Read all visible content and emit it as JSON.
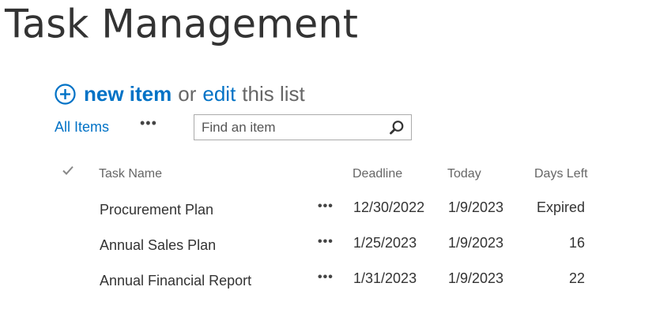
{
  "page": {
    "title": "Task Management"
  },
  "actions": {
    "new_item": "new item",
    "or": "or",
    "edit": "edit",
    "this_list": "this list"
  },
  "views": {
    "all_items": "All Items",
    "more": "•••"
  },
  "search": {
    "placeholder": "Find an item",
    "value": ""
  },
  "table": {
    "headers": {
      "task_name": "Task Name",
      "deadline": "Deadline",
      "today": "Today",
      "days_left": "Days Left"
    },
    "rows": [
      {
        "task_name": "Procurement Plan",
        "menu": "•••",
        "deadline": "12/30/2022",
        "today": "1/9/2023",
        "days_left": "Expired"
      },
      {
        "task_name": "Annual Sales Plan",
        "menu": "•••",
        "deadline": "1/25/2023",
        "today": "1/9/2023",
        "days_left": "16"
      },
      {
        "task_name": "Annual Financial Report",
        "menu": "•••",
        "deadline": "1/31/2023",
        "today": "1/9/2023",
        "days_left": "22"
      }
    ]
  },
  "icons": {
    "add": "plus-circle-icon",
    "search": "search-icon",
    "select_all": "checkmark-icon"
  },
  "colors": {
    "accent": "#0072c6",
    "text": "#333333",
    "muted": "#666666"
  }
}
